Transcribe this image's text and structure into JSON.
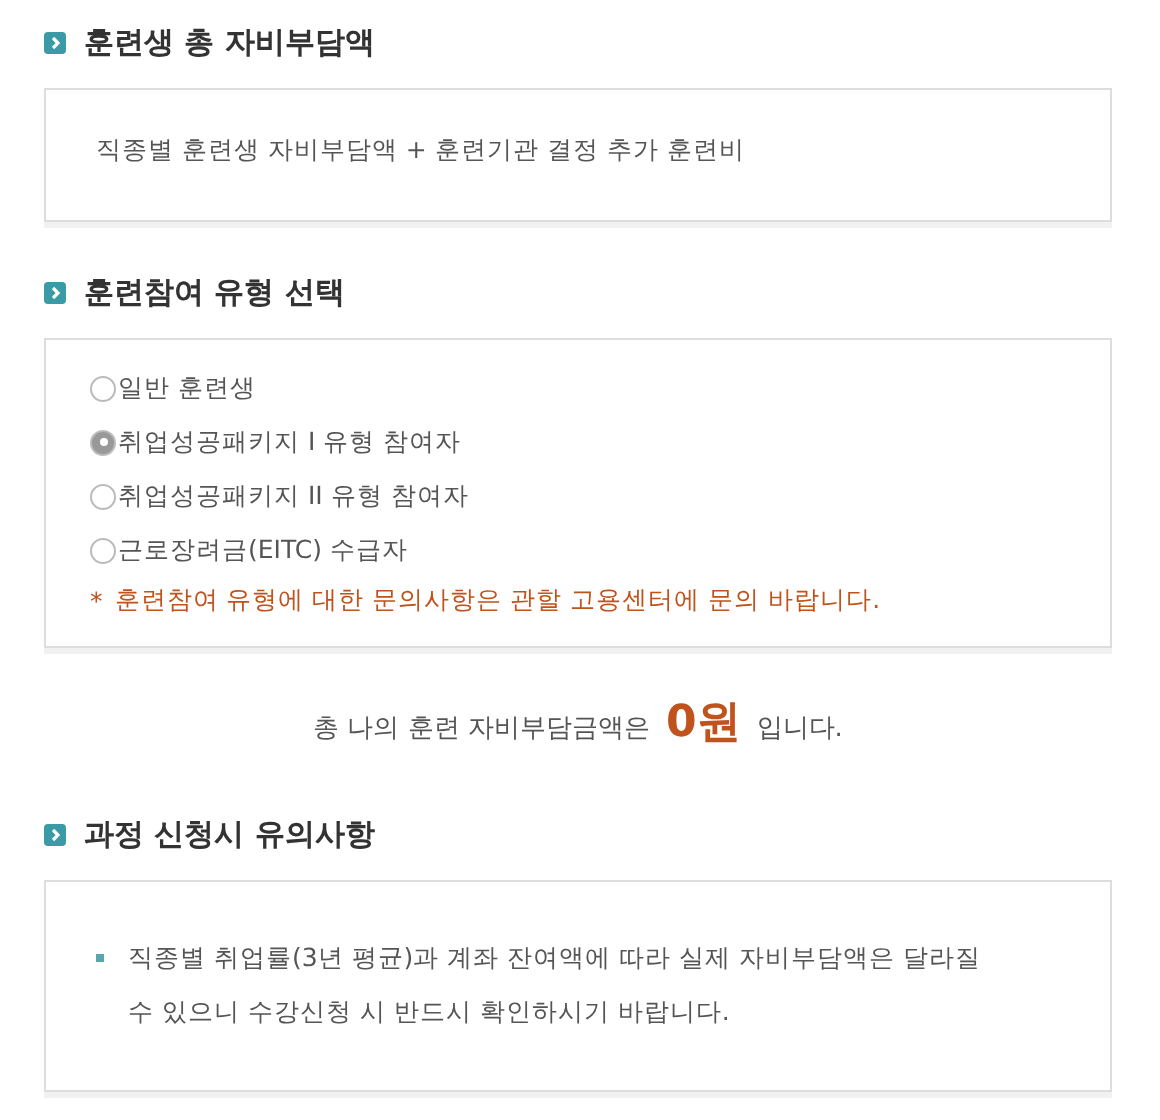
{
  "sections": [
    {
      "kind": "text",
      "title": "훈련생 총 자비부담액",
      "text": "직종별 훈련생 자비부담액 + 훈련기관 결정 추가 훈련비"
    },
    {
      "kind": "radios",
      "title": "훈련참여 유형 선택",
      "options": [
        {
          "label": "일반 훈련생",
          "selected": false
        },
        {
          "label": "취업성공패키지 I 유형 참여자",
          "selected": true
        },
        {
          "label": "취업성공패키지 II 유형 참여자",
          "selected": false
        },
        {
          "label": "근로장려금(EITC) 수급자",
          "selected": false
        }
      ],
      "note": {
        "marker": "*",
        "text": "훈련참여 유형에 대한 문의사항은 관할 고용센터에 문의 바랍니다."
      }
    },
    {
      "kind": "total",
      "label": "총 나의 훈련 자비부담금액은",
      "amount": "0원",
      "suffix": "입니다."
    },
    {
      "kind": "bullets",
      "title": "과정 신청시 유의사항",
      "items": [
        "직종별 취업률(3년 평균)과 계좌 잔여액에 따라 실제 자비부담액은 달라질 수 있으니 수강신청 시 반드시 확인하시기 바랍니다."
      ]
    }
  ]
}
